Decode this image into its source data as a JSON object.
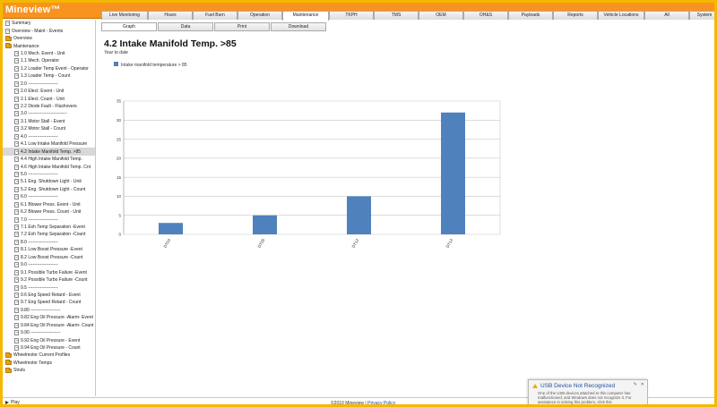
{
  "app": {
    "title": "Mineview™"
  },
  "nav_tabs": [
    {
      "label": "Live Monitoring",
      "w": 52
    },
    {
      "label": "Hours",
      "w": 50
    },
    {
      "label": "Fuel Burn",
      "w": 50
    },
    {
      "label": "Operation",
      "w": 50
    },
    {
      "label": "Maintenance",
      "w": 52,
      "active": true
    },
    {
      "label": "TKPH",
      "w": 50
    },
    {
      "label": "TMS",
      "w": 50
    },
    {
      "label": "OEM",
      "w": 50
    },
    {
      "label": "OH&S",
      "w": 50
    },
    {
      "label": "Payloads",
      "w": 50
    },
    {
      "label": "Reports",
      "w": 50
    },
    {
      "label": "Vehicle Locations",
      "w": 52
    },
    {
      "label": "All",
      "w": 50
    },
    {
      "label": "System",
      "w": 34
    }
  ],
  "sub_tabs": [
    {
      "label": "Graph",
      "active": true
    },
    {
      "label": "Data"
    },
    {
      "label": "Print"
    },
    {
      "label": "Download"
    }
  ],
  "sidebar": {
    "items": [
      {
        "label": "Summary",
        "icon": "doc",
        "indent": 0
      },
      {
        "label": "Overview - Maint - Events",
        "icon": "doc",
        "indent": 0
      },
      {
        "label": "Overview",
        "icon": "folder",
        "indent": 0
      },
      {
        "label": "Maintenance",
        "icon": "folder",
        "indent": 0
      },
      {
        "label": "1.0 Mech. Event - Unit",
        "icon": "doc",
        "indent": 1
      },
      {
        "label": "1.1 Mech. Operator",
        "icon": "doc",
        "indent": 1
      },
      {
        "label": "1.2 Loader Temp Event - Operator",
        "icon": "doc",
        "indent": 1
      },
      {
        "label": "1.3 Loader Temp - Count",
        "icon": "doc",
        "indent": 1
      },
      {
        "label": "2.0 --------------------",
        "icon": "doc",
        "indent": 1
      },
      {
        "label": "2.0 Elect. Event - Unit",
        "icon": "doc",
        "indent": 1
      },
      {
        "label": "2.1 Elect. Count - Unit",
        "icon": "doc",
        "indent": 1
      },
      {
        "label": "2.2 Diode Fault - Flashovers",
        "icon": "doc",
        "indent": 1
      },
      {
        "label": "3.0 --------------------------",
        "icon": "doc",
        "indent": 1
      },
      {
        "label": "3.1 Motor Stall - Event",
        "icon": "doc",
        "indent": 1
      },
      {
        "label": "3.2 Motor Stall - Count",
        "icon": "doc",
        "indent": 1
      },
      {
        "label": "4.0 --------------------",
        "icon": "doc",
        "indent": 1
      },
      {
        "label": "4.1 Low Intake Manifold Pressure",
        "icon": "doc",
        "indent": 1
      },
      {
        "label": "4.2 Intake Manifold Temp. >85",
        "icon": "doc",
        "indent": 1,
        "selected": true
      },
      {
        "label": "4.4 High Intake Manifold Temp.",
        "icon": "doc",
        "indent": 1
      },
      {
        "label": "4.6 High Intake Manifold Temp. Cnt",
        "icon": "doc",
        "indent": 1
      },
      {
        "label": "5.0 --------------------",
        "icon": "doc",
        "indent": 1
      },
      {
        "label": "5.1 Eng. Shutdown Light - Unit",
        "icon": "doc",
        "indent": 1
      },
      {
        "label": "5.2 Eng. Shutdown Light - Count",
        "icon": "doc",
        "indent": 1
      },
      {
        "label": "6.0 --------------------",
        "icon": "doc",
        "indent": 1
      },
      {
        "label": "6.1 Blower Press. Event - Unit",
        "icon": "doc",
        "indent": 1
      },
      {
        "label": "6.2 Blower Press. Count - Unit",
        "icon": "doc",
        "indent": 1
      },
      {
        "label": "7.0 --------------------",
        "icon": "doc",
        "indent": 1
      },
      {
        "label": "7.1 Exh Temp Separation -Event",
        "icon": "doc",
        "indent": 1
      },
      {
        "label": "7.2 Exh Temp Separation -Count",
        "icon": "doc",
        "indent": 1
      },
      {
        "label": "8.0 --------------------",
        "icon": "doc",
        "indent": 1
      },
      {
        "label": "8.1 Low Boost Pressure -Event",
        "icon": "doc",
        "indent": 1
      },
      {
        "label": "8.2 Low Boost Pressure -Count",
        "icon": "doc",
        "indent": 1
      },
      {
        "label": "9.0 --------------------",
        "icon": "doc",
        "indent": 1
      },
      {
        "label": "9.1 Possible Turbo Failure -Event",
        "icon": "doc",
        "indent": 1
      },
      {
        "label": "9.2 Possible Turbo Failure -Count",
        "icon": "doc",
        "indent": 1
      },
      {
        "label": "9.5 --------------------",
        "icon": "doc",
        "indent": 1
      },
      {
        "label": "9.6 Eng Speed Retard - Event",
        "icon": "doc",
        "indent": 1
      },
      {
        "label": "9.7 Eng Speed Retard - Count",
        "icon": "doc",
        "indent": 1
      },
      {
        "label": "9.80 --------------------",
        "icon": "doc",
        "indent": 1
      },
      {
        "label": "9.82 Eng Oil Pressure -Alarm- Event",
        "icon": "doc",
        "indent": 1
      },
      {
        "label": "9.84 Eng Oil Pressure -Alarm- Count",
        "icon": "doc",
        "indent": 1
      },
      {
        "label": "9.90 --------------------",
        "icon": "doc",
        "indent": 1
      },
      {
        "label": "9.92 Eng Oil Pressure - Event",
        "icon": "doc",
        "indent": 1
      },
      {
        "label": "9.94 Eng Oil Pressure - Count",
        "icon": "doc",
        "indent": 1
      },
      {
        "label": "Wheelmotor Current Profiles",
        "icon": "folder",
        "indent": 0
      },
      {
        "label": "Wheelmotor Temps",
        "icon": "folder",
        "indent": 0
      },
      {
        "label": "Struts",
        "icon": "folder",
        "indent": 0
      }
    ]
  },
  "main": {
    "title": "4.2 Intake Manifold Temp. >85",
    "subtitle": "Year to date"
  },
  "chart_data": {
    "type": "bar",
    "categories": [
      "DT04",
      "DT05",
      "DT12",
      "DT14"
    ],
    "series": [
      {
        "name": "Intake manifold temperature > 85",
        "values": [
          3,
          5,
          10,
          32
        ]
      }
    ],
    "ylim": [
      0,
      35
    ],
    "yticks": [
      0,
      5,
      10,
      15,
      20,
      25,
      30,
      35
    ],
    "grid": true,
    "legend": "top-left",
    "bar_color": "#4f81bd"
  },
  "footer": {
    "play_label": "Play",
    "copyright": "©2010 Mineview |",
    "privacy_link": "Privacy Policy"
  },
  "notification": {
    "title": "USB Device Not Recognized",
    "body": "One of the USB devices attached to this computer has malfunctioned, and Windows does not recognize it. For assistance in solving this problem, click this"
  }
}
